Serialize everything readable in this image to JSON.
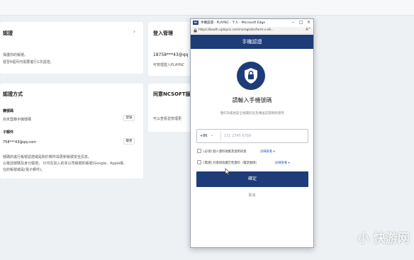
{
  "background": {
    "card_verify": {
      "title": "認證",
      "line1": "保護你的帳號。",
      "line2": "發至6個月內需要進行1次認證。"
    },
    "card_login": {
      "title": "登入管理",
      "account": "18758***43@qq",
      "note": "可管理登入PLAYNC"
    },
    "card_methods": {
      "title": "認證方式",
      "phone_label": "機號碼",
      "phone_status": "尚未登錄手機號碼",
      "phone_btn": "登錄",
      "email_label": "子郵件",
      "email_value": "758***43@qq.com",
      "email_btn": "變更",
      "note1": "號碼的進行帳號認證或是對於郵件與更新帳號安全訊息。",
      "note2": "以電話號碼及身分驗證。 只可在加入的本公司帳號的帳號(Google、Apple帳",
      "note3": "在的帳號或是(電子郵件)。"
    },
    "card_ncsoft": {
      "title": "同意NCSOFT服",
      "note": "可以查看並管理更"
    }
  },
  "popup": {
    "window_title": "手機認證 - PLAYNC - 个人 - Microsoft Edge",
    "app_icon": "nc",
    "url": "https://bauth.uplaync.com/ncregister/form-s.e8...",
    "reader_icon": "A^",
    "header": "手機認證",
    "title": "請輸入手機號碼",
    "subtitle": "僅作為帳號安全相關訊息及傳送認證碼時使用",
    "country_code": "+86",
    "phone_placeholder": "131 2345 6789",
    "agree1_text": "[必須] 個人資料收集及使用同意",
    "agree1_link": "詳細查看 ▾",
    "agree2_text": "[需選] 同意接收廣告性資料（電話號碼）",
    "agree2_link": "詳細查看 ▾",
    "confirm": "確定",
    "cancel": "取消"
  },
  "watermark": "小 快游网"
}
